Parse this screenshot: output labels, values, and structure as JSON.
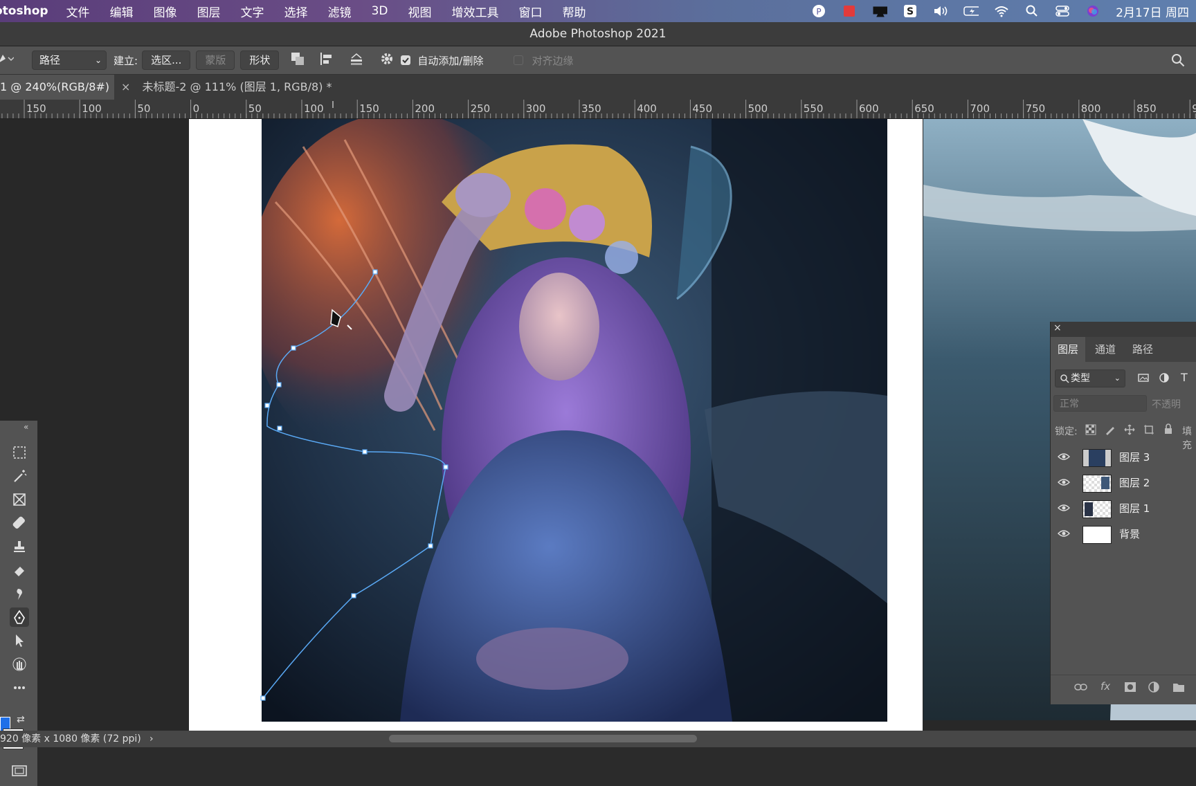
{
  "menubar": {
    "app": "otoshop",
    "items": [
      "文件",
      "编辑",
      "图像",
      "图层",
      "文字",
      "选择",
      "滤镜",
      "3D",
      "视图",
      "增效工具",
      "窗口",
      "帮助"
    ],
    "date": "2月17日 周四"
  },
  "window": {
    "title": "Adobe Photoshop 2021"
  },
  "options": {
    "mode": "路径",
    "make_label": "建立:",
    "select_btn": "选区...",
    "mask_btn": "蒙版",
    "shape_btn": "形状",
    "auto_add": "自动添加/删除",
    "align_edges": "对齐边缘"
  },
  "tabs": [
    {
      "label": "1 @ 240%(RGB/8#) *"
    },
    {
      "label": "未标题-2 @ 111% (图层 1, RGB/8) *"
    }
  ],
  "ruler": {
    "ticks": [
      "150",
      "100",
      "50",
      "0",
      "50",
      "100",
      "150",
      "200",
      "250",
      "300",
      "350",
      "400",
      "450",
      "500",
      "550",
      "600",
      "650",
      "700",
      "750",
      "800",
      "850",
      "9"
    ]
  },
  "layers_panel": {
    "tabs": [
      "图层",
      "通道",
      "路径"
    ],
    "filter": "类型",
    "blend_mode": "正常",
    "opacity_label": "不透明",
    "lock_label": "锁定:",
    "fill_label": "填充",
    "layers": [
      {
        "name": "图层 3"
      },
      {
        "name": "图层 2"
      },
      {
        "name": "图层 1"
      },
      {
        "name": "背景"
      }
    ]
  },
  "status": {
    "doc_size": "920 像素 x 1080 像素 (72 ppi)"
  },
  "colors": {
    "foreground": "#1e6fe8",
    "background": "#ffffff",
    "path": "#5aa9f5"
  }
}
